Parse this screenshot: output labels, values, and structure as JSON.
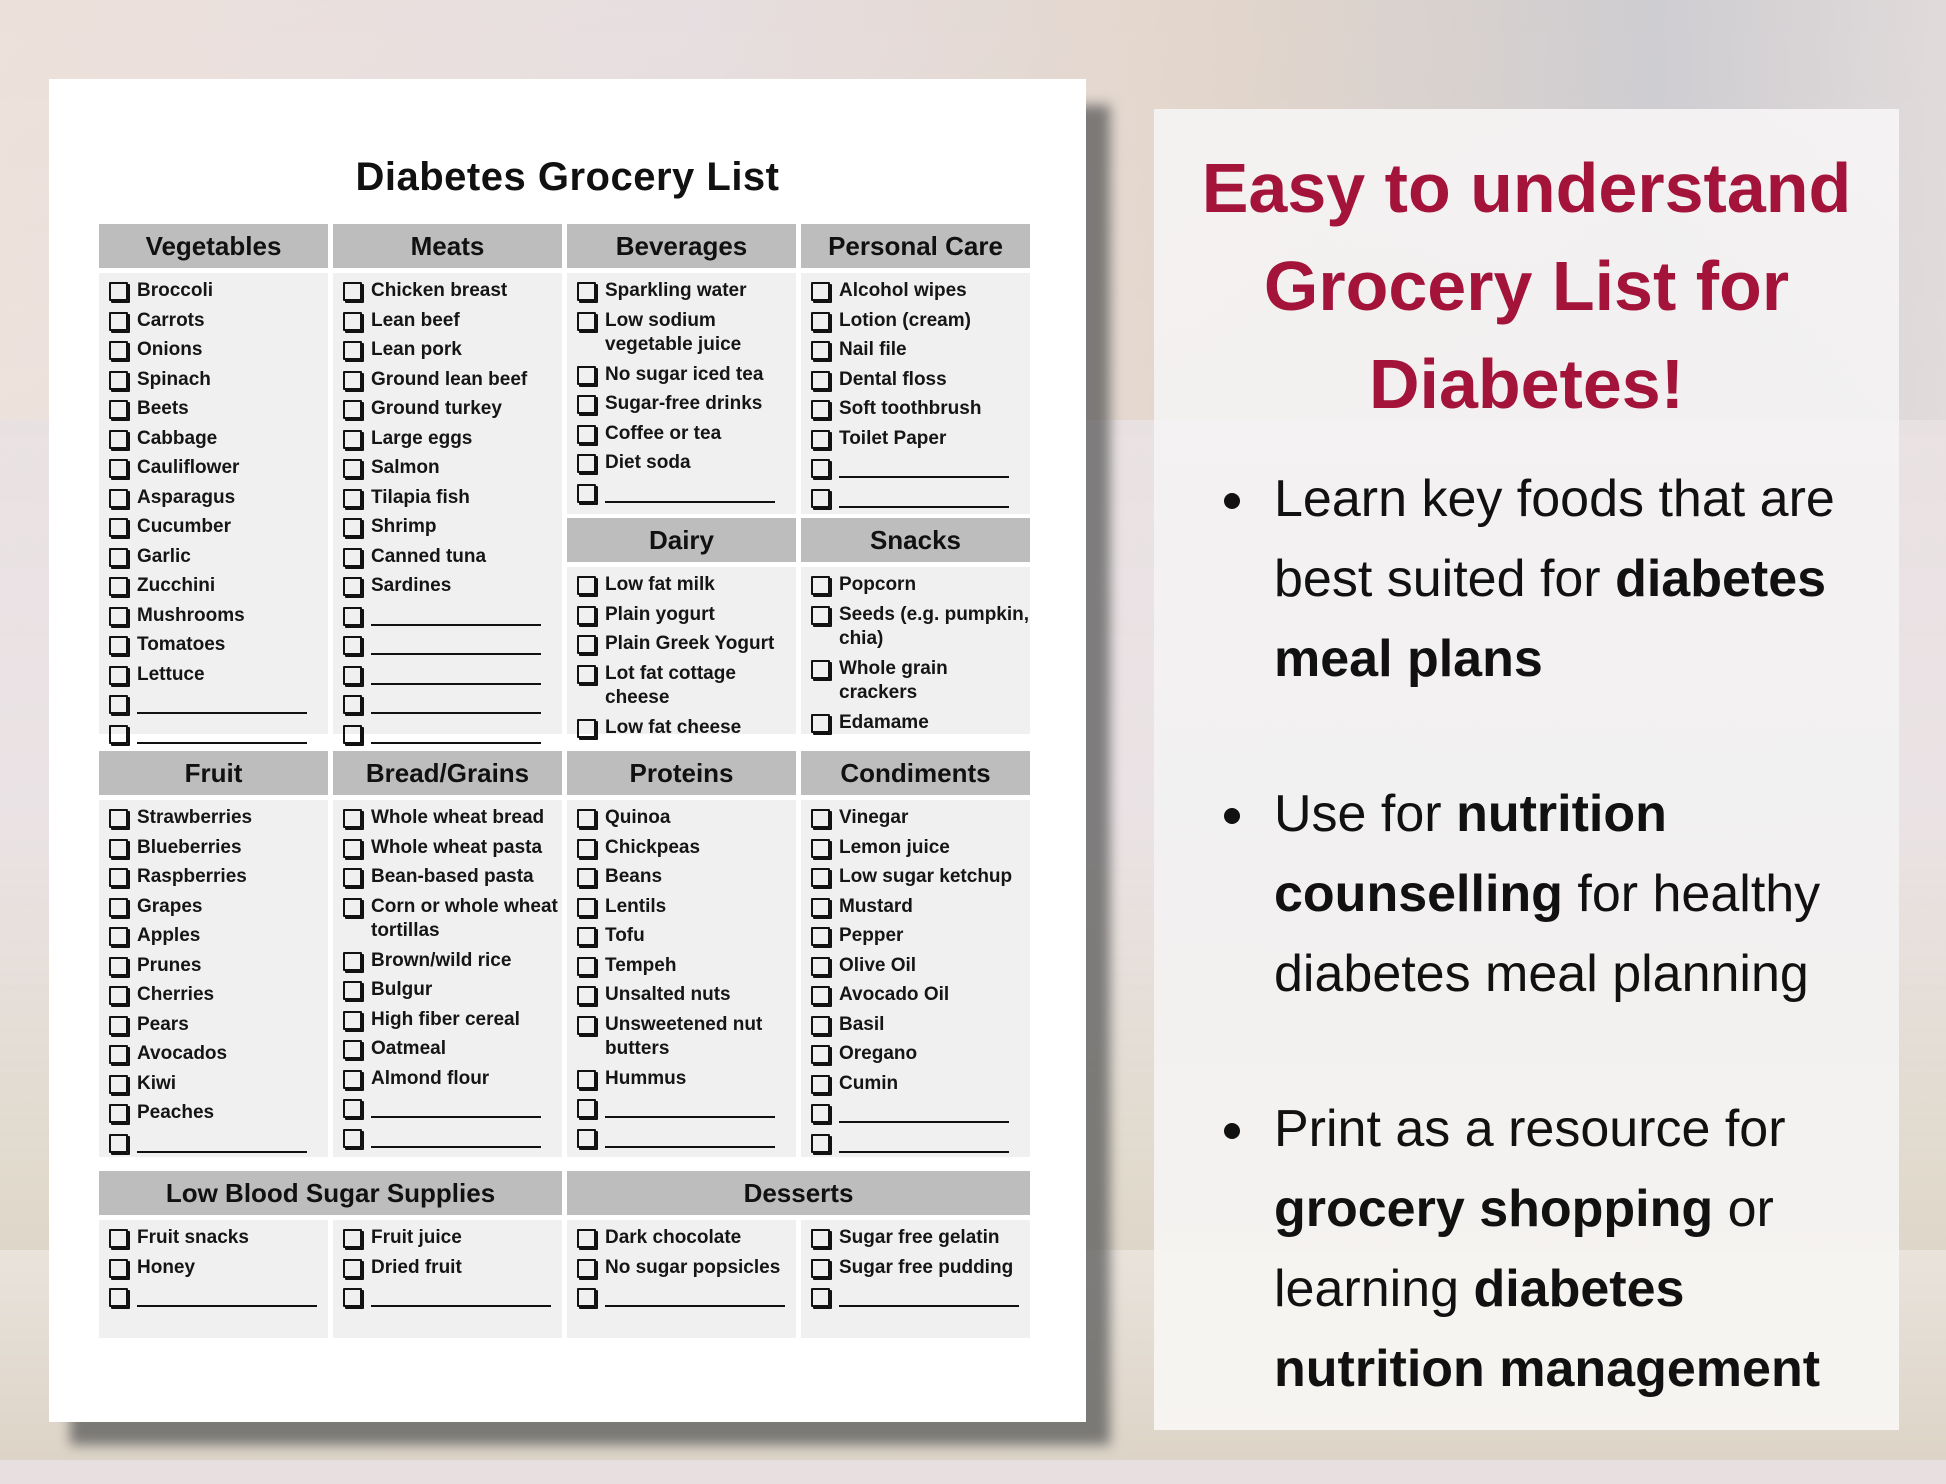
{
  "document": {
    "title": "Diabetes Grocery List",
    "sections": [
      {
        "name": "Vegetables",
        "items": [
          "Broccoli",
          "Carrots",
          "Onions",
          "Spinach",
          "Beets",
          "Cabbage",
          "Cauliflower",
          "Asparagus",
          "Cucumber",
          "Garlic",
          "Zucchini",
          "Mushrooms",
          "Tomatoes",
          "Lettuce"
        ],
        "blank_lines": 2
      },
      {
        "name": "Meats",
        "items": [
          "Chicken breast",
          "Lean beef",
          "Lean pork",
          "Ground lean beef",
          "Ground turkey",
          "Large eggs",
          "Salmon",
          "Tilapia fish",
          "Shrimp",
          "Canned tuna",
          "Sardines"
        ],
        "blank_lines": 5
      },
      {
        "name": "Beverages",
        "items": [
          "Sparkling water",
          "Low sodium vegetable juice",
          "No sugar iced tea",
          "Sugar-free drinks",
          "Coffee or tea",
          "Diet soda"
        ],
        "blank_lines": 1
      },
      {
        "name": "Personal Care",
        "items": [
          "Alcohol wipes",
          "Lotion (cream)",
          "Nail file",
          "Dental floss",
          "Soft toothbrush",
          "Toilet Paper"
        ],
        "blank_lines": 2
      },
      {
        "name": "Dairy",
        "items": [
          "Low fat milk",
          "Plain yogurt",
          "Plain Greek Yogurt",
          "Lot fat cottage cheese",
          "Low fat cheese"
        ],
        "blank_lines": 0
      },
      {
        "name": "Snacks",
        "items": [
          "Popcorn",
          "Seeds (e.g. pumpkin, chia)",
          "Whole grain crackers",
          "Edamame"
        ],
        "blank_lines": 0
      },
      {
        "name": "Fruit",
        "items": [
          "Strawberries",
          "Blueberries",
          "Raspberries",
          "Grapes",
          "Apples",
          "Prunes",
          "Cherries",
          "Pears",
          "Avocados",
          "Kiwi",
          "Peaches"
        ],
        "blank_lines": 1
      },
      {
        "name": "Bread/Grains",
        "items": [
          "Whole wheat bread",
          "Whole wheat pasta",
          "Bean-based pasta",
          "Corn or whole wheat tortillas",
          "Brown/wild rice",
          "Bulgur",
          "High fiber cereal",
          "Oatmeal",
          "Almond flour"
        ],
        "blank_lines": 2
      },
      {
        "name": "Proteins",
        "items": [
          "Quinoa",
          "Chickpeas",
          "Beans",
          "Lentils",
          "Tofu",
          "Tempeh",
          "Unsalted nuts",
          "Unsweetened nut butters",
          "Hummus"
        ],
        "blank_lines": 2
      },
      {
        "name": "Condiments",
        "items": [
          "Vinegar",
          "Lemon juice",
          "Low sugar ketchup",
          "Mustard",
          "Pepper",
          "Olive Oil",
          "Avocado Oil",
          "Basil",
          "Oregano",
          "Cumin"
        ],
        "blank_lines": 2
      },
      {
        "name": "Low Blood Sugar Supplies",
        "columns": [
          {
            "items": [
              "Fruit snacks",
              "Honey"
            ],
            "blank_lines": 1
          },
          {
            "items": [
              "Fruit juice",
              "Dried fruit"
            ],
            "blank_lines": 1
          }
        ]
      },
      {
        "name": "Desserts",
        "columns": [
          {
            "items": [
              "Dark chocolate",
              "No sugar popsicles"
            ],
            "blank_lines": 1
          },
          {
            "items": [
              "Sugar free gelatin",
              "Sugar free pudding"
            ],
            "blank_lines": 1
          }
        ]
      }
    ],
    "checkbox_icon": "empty-checkbox-icon"
  },
  "promo": {
    "headline": "Easy to understand Grocery List for Diabetes!",
    "headline_color": "#a3133a",
    "bullets": [
      [
        {
          "t": "Learn key foods that are best suited for ",
          "b": false
        },
        {
          "t": "diabetes meal plans",
          "b": true
        }
      ],
      [
        {
          "t": "Use for ",
          "b": false
        },
        {
          "t": "nutrition counselling",
          "b": true
        },
        {
          "t": " for healthy diabetes meal planning",
          "b": false
        }
      ],
      [
        {
          "t": "Print as a resource for ",
          "b": false
        },
        {
          "t": "grocery shopping",
          "b": true
        },
        {
          "t": " or learning ",
          "b": false
        },
        {
          "t": "diabetes nutrition management",
          "b": true
        }
      ]
    ]
  }
}
